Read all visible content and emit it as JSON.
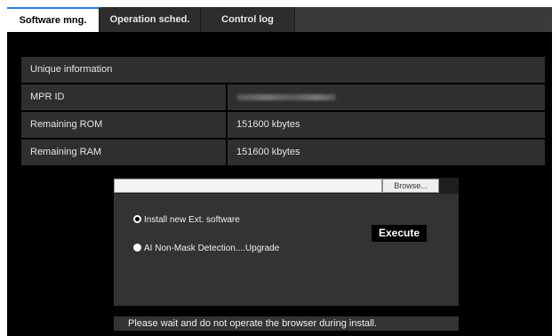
{
  "tabs": [
    {
      "label": "Software mng.",
      "active": true
    },
    {
      "label": "Operation sched.",
      "active": false
    },
    {
      "label": "Control log",
      "active": false
    }
  ],
  "info": {
    "header": "Unique information",
    "rows": [
      {
        "label": "MPR ID",
        "value": ""
      },
      {
        "label": "Remaining ROM",
        "value": "151600 kbytes"
      },
      {
        "label": "Remaining RAM",
        "value": "151600 kbytes"
      }
    ]
  },
  "install": {
    "browse_label": "Browse...",
    "file_value": "",
    "options": [
      {
        "label": "Install new Ext. software",
        "checked": true
      },
      {
        "label": "AI Non-Mask Detection....Upgrade",
        "checked": false
      }
    ],
    "execute_label": "Execute",
    "notice": "Please wait and do not operate the browser during install."
  },
  "colors": {
    "background": "#000000",
    "row": "#2f2f2f",
    "panel": "#333333",
    "active_tab_accent": "#2a7de1"
  }
}
